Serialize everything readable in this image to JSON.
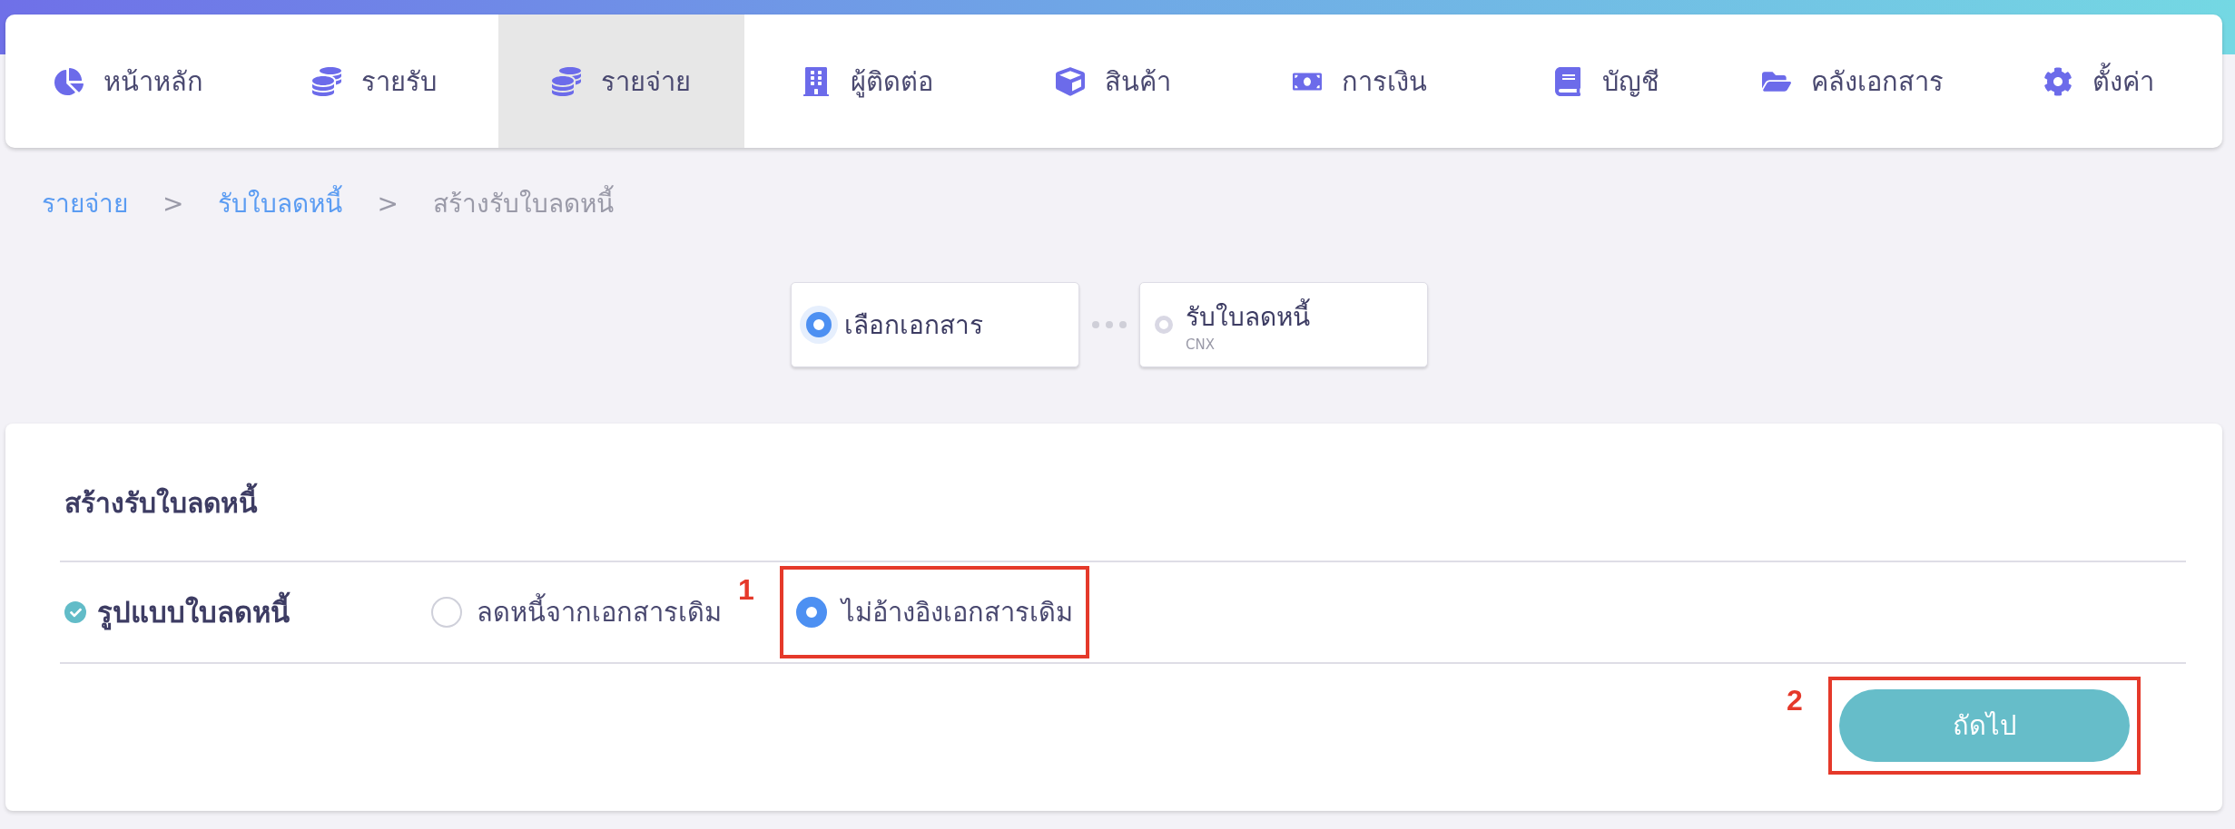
{
  "nav": {
    "items": [
      {
        "label": "หน้าหลัก",
        "selected": false
      },
      {
        "label": "รายรับ",
        "selected": false
      },
      {
        "label": "รายจ่าย",
        "selected": true
      },
      {
        "label": "ผู้ติดต่อ",
        "selected": false
      },
      {
        "label": "สินค้า",
        "selected": false
      },
      {
        "label": "การเงิน",
        "selected": false
      },
      {
        "label": "บัญชี",
        "selected": false
      },
      {
        "label": "คลังเอกสาร",
        "selected": false
      },
      {
        "label": "ตั้งค่า",
        "selected": false
      }
    ]
  },
  "breadcrumb": [
    {
      "label": "รายจ่าย",
      "kind": "link"
    },
    {
      "label": ">",
      "kind": "separator"
    },
    {
      "label": "รับใบลดหนี้",
      "kind": "link"
    },
    {
      "label": ">",
      "kind": "separator"
    },
    {
      "label": "สร้างรับใบลดหนี้",
      "kind": "current"
    }
  ],
  "steps": [
    {
      "label": "เลือกเอกสาร",
      "selected": true
    },
    {
      "label": "รับใบลดหนี้",
      "sub": "CNX",
      "selected": false
    }
  ],
  "form": {
    "title": "สร้างรับใบลดหนี้",
    "field_label": "รูปแบบใบลดหนี้",
    "options": [
      {
        "label": "ลดหนี้จากเอกสารเดิม",
        "selected": false
      },
      {
        "label": "ไม่อ้างอิงเอกสารเดิม",
        "selected": true,
        "annotation": "1"
      }
    ],
    "next_button": {
      "label": "ถัดไป",
      "annotation": "2"
    }
  }
}
